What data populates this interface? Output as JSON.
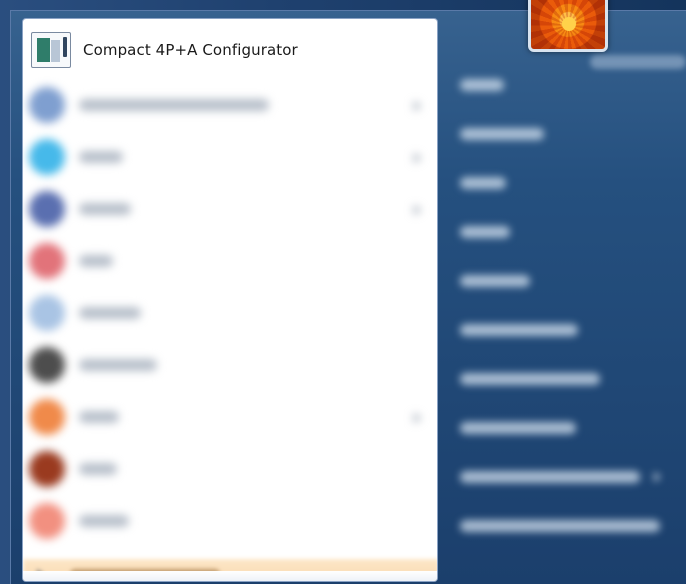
{
  "pinned_program": {
    "label": "Compact 4P+A Configurator",
    "icon": "configurator-app-icon"
  },
  "user_picture": {
    "icon": "orange-flower-avatar"
  },
  "colors": {
    "menu_background": "#1b3f6c",
    "left_pane_background": "#ffffff",
    "highlight": "#f8d4a7"
  }
}
